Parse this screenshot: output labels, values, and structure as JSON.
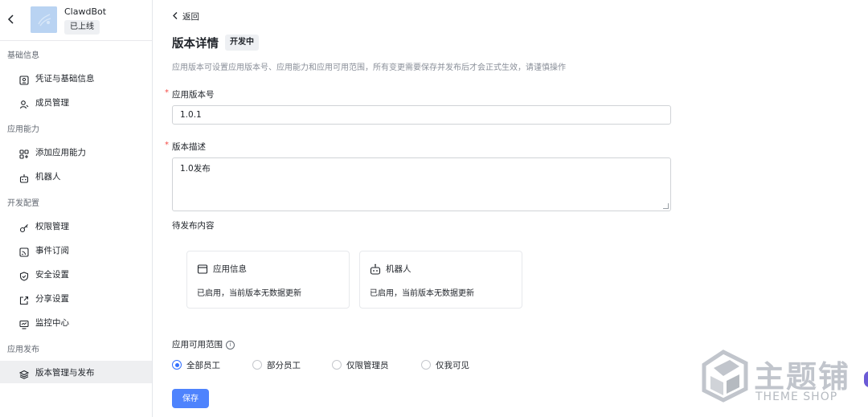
{
  "app": {
    "name": "ClawdBot",
    "status": "已上线"
  },
  "sidebar": {
    "groups": [
      {
        "title": "基础信息",
        "items": [
          {
            "label": "凭证与基础信息",
            "icon": "credential-icon"
          },
          {
            "label": "成员管理",
            "icon": "member-icon"
          }
        ]
      },
      {
        "title": "应用能力",
        "items": [
          {
            "label": "添加应用能力",
            "icon": "add-capability-icon"
          },
          {
            "label": "机器人",
            "icon": "robot-icon"
          }
        ]
      },
      {
        "title": "开发配置",
        "items": [
          {
            "label": "权限管理",
            "icon": "permission-icon"
          },
          {
            "label": "事件订阅",
            "icon": "event-icon"
          },
          {
            "label": "安全设置",
            "icon": "shield-icon"
          },
          {
            "label": "分享设置",
            "icon": "share-icon"
          },
          {
            "label": "监控中心",
            "icon": "monitor-icon"
          }
        ]
      },
      {
        "title": "应用发布",
        "items": [
          {
            "label": "版本管理与发布",
            "icon": "layers-icon",
            "active": true
          }
        ]
      }
    ]
  },
  "main": {
    "back_label": "返回",
    "title": "版本详情",
    "status_badge": "开发中",
    "description": "应用版本可设置应用版本号、应用能力和应用可用范围，所有变更需要保存并发布后才会正式生效，请谨慎操作",
    "version_field": {
      "label": "应用版本号",
      "value": "1.0.1",
      "required_mark": "*"
    },
    "desc_field": {
      "label": "版本描述",
      "value": "1.0发布",
      "required_mark": "*"
    },
    "pending_label": "待发布内容",
    "cards": [
      {
        "title": "应用信息",
        "text": "已启用，当前版本无数据更新",
        "icon": "app-info-icon"
      },
      {
        "title": "机器人",
        "text": "已启用，当前版本无数据更新",
        "icon": "robot-icon"
      }
    ],
    "scope": {
      "label": "应用可用范围",
      "info_icon": "i",
      "options": [
        {
          "label": "全部员工",
          "checked": true
        },
        {
          "label": "部分员工",
          "checked": false
        },
        {
          "label": "仅限管理员",
          "checked": false
        },
        {
          "label": "仅我可见",
          "checked": false
        }
      ]
    },
    "save_label": "保存"
  },
  "watermark": {
    "cn": "主题铺",
    "en": "THEME SHOP"
  },
  "colors": {
    "primary": "#3370ff",
    "button": "#4e83fd",
    "required": "#f54a45",
    "active_bg": "#eeeff1"
  }
}
